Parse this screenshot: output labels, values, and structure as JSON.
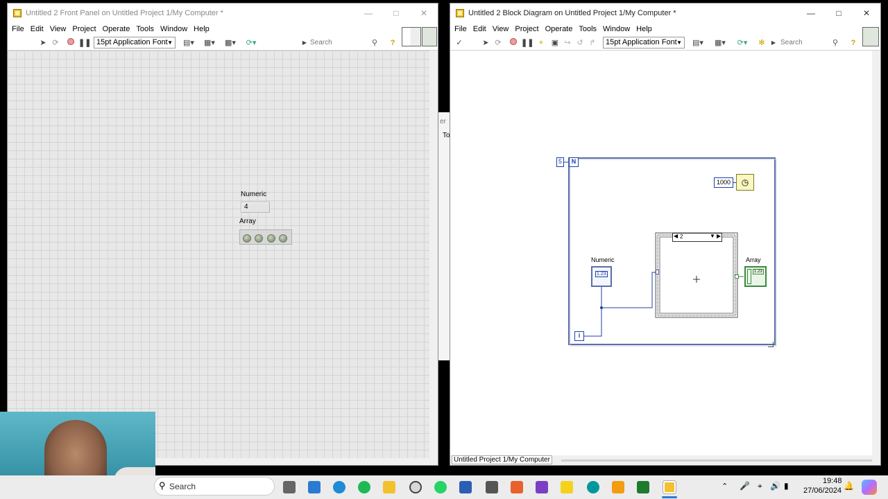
{
  "front_panel": {
    "title": "Untitled 2 Front Panel on Untitled Project 1/My Computer *",
    "menu": [
      "File",
      "Edit",
      "View",
      "Project",
      "Operate",
      "Tools",
      "Window",
      "Help"
    ],
    "font_select": "15pt Application Font",
    "search_placeholder": "Search",
    "numeric_label": "Numeric",
    "numeric_value": "4",
    "array_label": "Array",
    "array_led_count": 4
  },
  "block_diagram": {
    "title": "Untitled 2 Block Diagram on Untitled Project 1/My Computer *",
    "menu": [
      "File",
      "Edit",
      "View",
      "Project",
      "Operate",
      "Tools",
      "Window",
      "Help"
    ],
    "font_select": "15pt Application Font",
    "search_placeholder": "Search",
    "for_loop_count": "5",
    "for_loop_n": "N",
    "for_loop_i": "i",
    "wait_constant": "1000",
    "numeric_label": "Numeric",
    "numeric_terminal": "1.23",
    "array_label": "Array",
    "array_terminal": "1.23",
    "case_selector": "2",
    "status_project": "Untitled Project 1/My Computer"
  },
  "background_window": {
    "fragment_1": "er",
    "fragment_2": "To"
  },
  "taskbar": {
    "search_placeholder": "Search",
    "time": "19:48",
    "date": "27/06/2024"
  },
  "colors": {
    "loop_border": "#5a6ea8",
    "wire_blue": "#1f3fa8",
    "wire_orange": "#e08a1e",
    "canvas_grid": "#e8e8e8",
    "title_inactive": "#888888"
  }
}
